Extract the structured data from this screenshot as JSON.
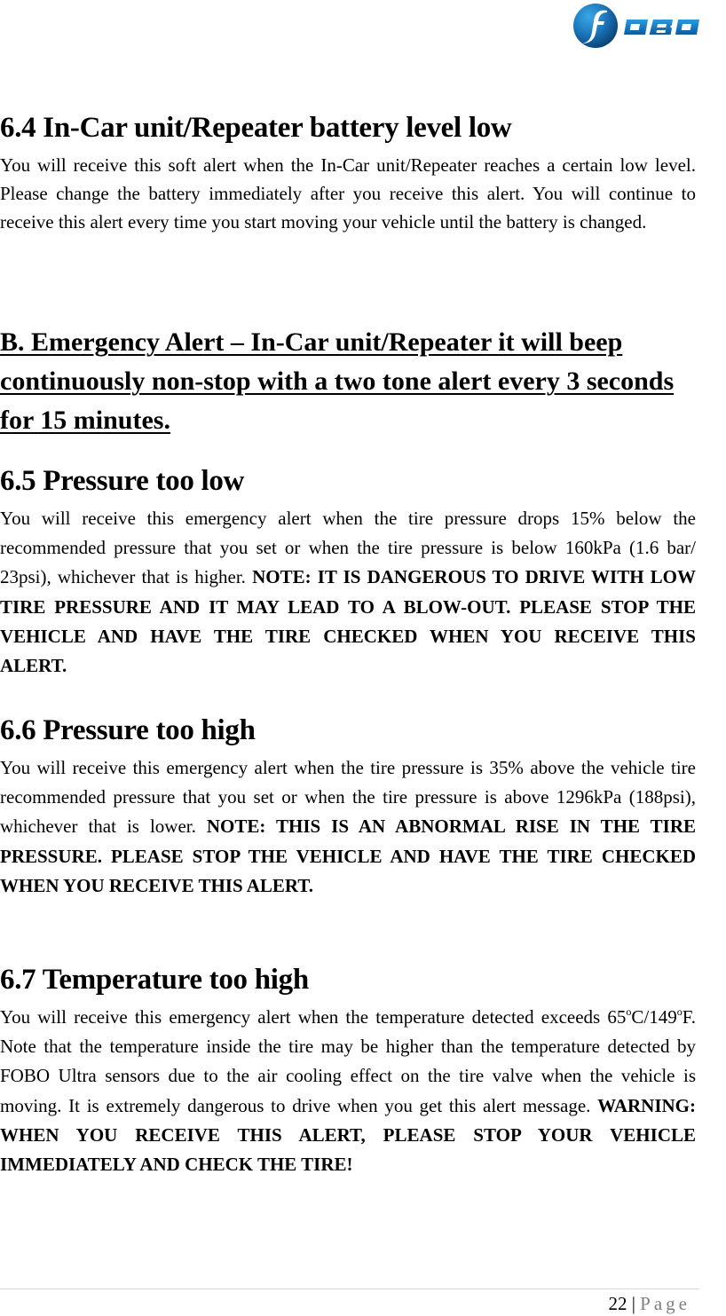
{
  "header": {
    "logo_text": "FOBO",
    "logo_icon": "fobo-logo-icon",
    "brand_colors": {
      "primary_blue": "#1a74b8",
      "dark_blue": "#0b3f73",
      "accent": "#2a9be0"
    }
  },
  "sections": {
    "s64": {
      "title": "6.4 In-Car unit/Repeater battery level low",
      "body": "You will receive this soft alert when the In-Car unit/Repeater reaches a certain low level. Please change the battery immediately after you receive this alert. You will continue to receive this alert every time you start moving your vehicle until the battery is changed."
    },
    "emergency_heading": "B. Emergency Alert – In-Car unit/Repeater it will beep continuously non-stop with a two tone alert every 3 seconds for 15 minutes.",
    "s65": {
      "title": "6.5 Pressure too low",
      "body": "You will receive this emergency alert when the tire pressure drops 15% below the recommended pressure that you set or when the tire pressure is below 160kPa (1.6 bar/ 23psi), whichever that is higher. ",
      "note": "NOTE: IT IS DANGEROUS TO DRIVE WITH LOW TIRE PRESSURE AND IT MAY LEAD TO A BLOW-OUT. PLEASE STOP THE VEHICLE AND HAVE THE TIRE CHECKED WHEN YOU RECEIVE THIS ALERT."
    },
    "s66": {
      "title": "6.6 Pressure too high",
      "body": "You will receive this emergency alert when the tire pressure is 35% above the vehicle tire recommended pressure that you set or when the tire pressure is above 1296kPa (188psi), whichever that is lower. ",
      "note": "NOTE: THIS IS AN ABNORMAL RISE IN THE TIRE PRESSURE. PLEASE STOP THE VEHICLE AND HAVE THE TIRE CHECKED WHEN YOU RECEIVE THIS ALERT."
    },
    "s67": {
      "title": "6.7 Temperature too high",
      "body_part1": "You will receive this emergency alert when the temperature detected exceeds 65",
      "deg1": "o",
      "body_part2": "C/149",
      "deg2": "o",
      "body_part3": "F. Note that the temperature inside the tire may be higher than the temperature detected by FOBO Ultra sensors due to the air cooling effect on the tire valve when the vehicle is moving. It is extremely dangerous to drive when you get this alert message. ",
      "warning": "WARNING: WHEN YOU RECEIVE THIS ALERT, PLEASE STOP YOUR VEHICLE IMMEDIATELY AND CHECK THE TIRE!"
    }
  },
  "footer": {
    "page_number": "22",
    "separator": " | ",
    "page_label": "Page"
  }
}
